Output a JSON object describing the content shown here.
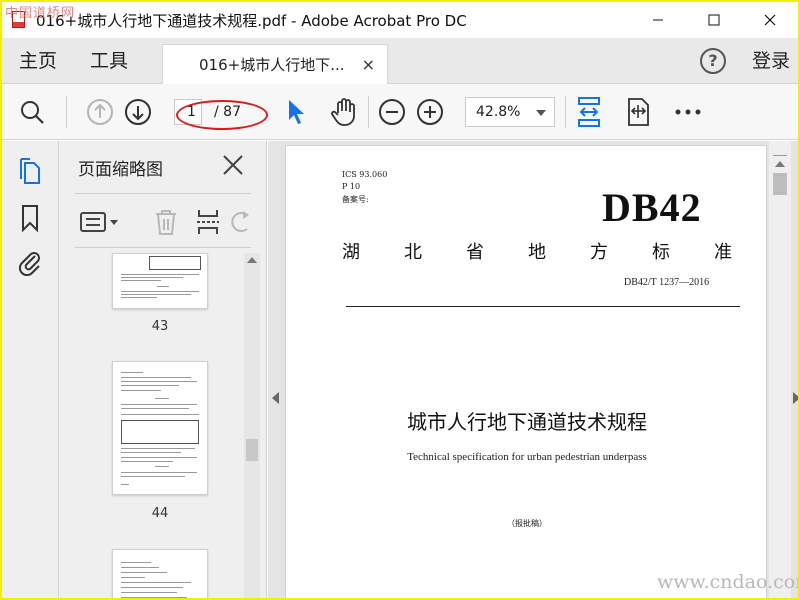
{
  "window": {
    "title": "016+城市人行地下通道技术规程.pdf - Adobe Acrobat Pro DC",
    "watermark_top": "中国道桥网",
    "watermark_bottom": "www.cndao.com"
  },
  "menu": {
    "home_label": "主页",
    "tools_label": "工具",
    "doc_tab_label": "016+城市人行地下...",
    "doc_tab_close": "×",
    "help_label": "?",
    "login_label": "登录"
  },
  "toolbar": {
    "current_page": "1",
    "total_pages": "/ 87",
    "zoom": "42.8%",
    "accent": "#1473e6",
    "annotation_color": "#d91c1c"
  },
  "thumb_panel": {
    "title": "页面缩略图",
    "thumbnails": [
      {
        "label": "43"
      },
      {
        "label": "44"
      }
    ]
  },
  "document": {
    "ics": "ICS 93.060",
    "p": "P 10",
    "filing": "备案号:",
    "code": "DB42",
    "org_chars": [
      "湖",
      "北",
      "省",
      "地",
      "方",
      "标",
      "准"
    ],
    "std_number": "DB42/T 1237—2016",
    "title": "城市人行地下通道技术规程",
    "subtitle": "Technical specification for urban pedestrian underpass",
    "draft": "（报批稿）"
  }
}
